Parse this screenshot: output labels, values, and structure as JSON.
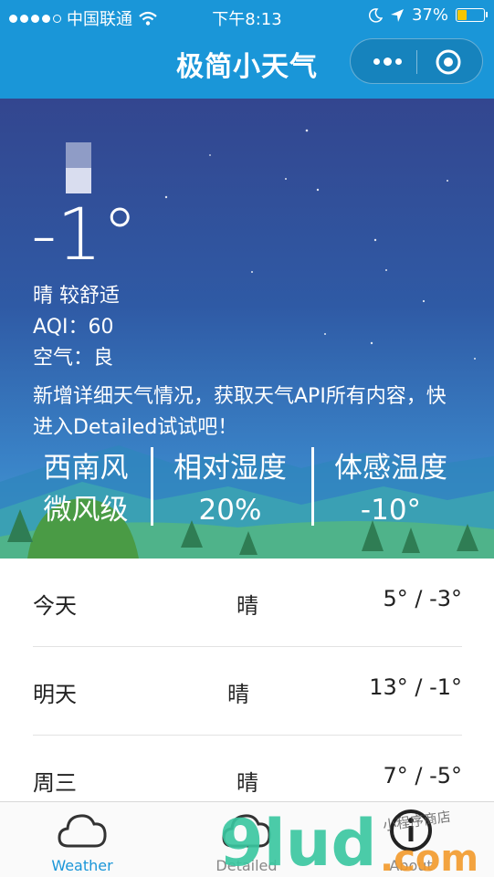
{
  "status_bar": {
    "carrier": "中国联通",
    "time": "下午8:13",
    "battery": "37%",
    "battery_level": 0.37
  },
  "nav": {
    "title": "极简小天气"
  },
  "current": {
    "temperature": "-1°",
    "description": "晴 较舒适",
    "aqi": "AQI：60",
    "air_quality": "空气：良",
    "notice": "新增详细天气情况，获取天气API所有内容，快进入Detailed试试吧！"
  },
  "stats": [
    {
      "title": "西南风",
      "value": "微风级"
    },
    {
      "title": "相对湿度",
      "value": "20%"
    },
    {
      "title": "体感温度",
      "value": "-10°"
    }
  ],
  "forecast": [
    {
      "day": "今天",
      "condition": "晴",
      "range": "5° / -3°"
    },
    {
      "day": "明天",
      "condition": "晴",
      "range": "13° / -1°"
    },
    {
      "day": "周三",
      "condition": "晴",
      "range": "7° / -5°"
    }
  ],
  "tabs": [
    {
      "label": "Weather",
      "icon": "cloud-icon",
      "active": true
    },
    {
      "label": "Detailed",
      "icon": "cloud-detailed-icon",
      "active": false
    },
    {
      "label": "About",
      "icon": "info-icon",
      "active": false
    }
  ],
  "watermark": {
    "text": "9lud.com",
    "tagline": "小程序商店"
  },
  "colors": {
    "header": "#1a96d8",
    "active_tab": "#1a96d8",
    "sky_top": "#33468f",
    "sky_bottom": "#4ea3d2",
    "battery": "#f7c600"
  }
}
